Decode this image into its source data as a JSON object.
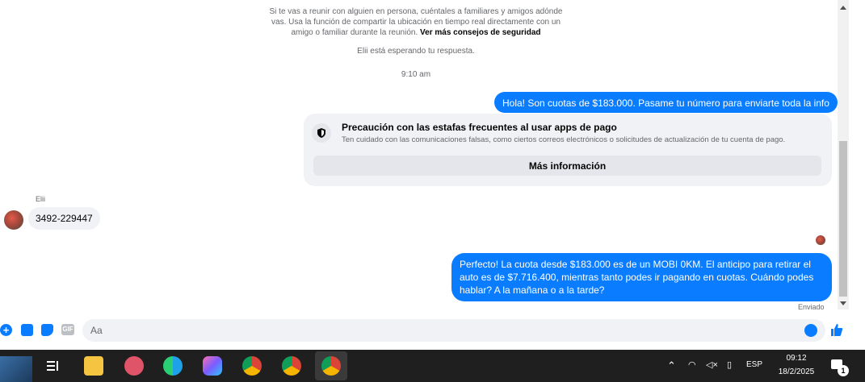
{
  "chat": {
    "safety_notice": "Si te vas a reunir con alguien en persona, cuéntales a familiares y amigos adónde vas. Usa la función de compartir la ubicación en tiempo real directamente con un amigo o familiar durante la reunión.",
    "safety_link": "Ver más consejos de seguridad",
    "waiting_text": "Elii está esperando tu respuesta.",
    "timestamp": "9:10 am",
    "msg_out_1": "Hola! Son cuotas de $183.000. Pasame tu número para enviarte toda la info",
    "warning_card": {
      "title": "Precaución con las estafas frecuentes al usar apps de pago",
      "description": "Ten cuidado con las comunicaciones falsas, como ciertos correos electrónicos o solicitudes de actualización de tu cuenta de pago.",
      "button": "Más información"
    },
    "contact_name": "Elii",
    "msg_in_1": "3492-229447",
    "msg_out_2": "Perfecto! La cuota desde $183.000 es de un MOBI 0KM. El anticipo para retirar el auto es de $7.716.400, mientras tanto podes ir pagando en cuotas. Cuándo podes hablar? A la mañana o a la tarde?",
    "status": "Enviado"
  },
  "composer": {
    "placeholder": "Aa",
    "icons": [
      "plus-icon",
      "photo-icon",
      "sticker-icon",
      "gif-icon",
      "emoji-icon",
      "like-icon"
    ],
    "gif_label": "GIF"
  },
  "taskbar": {
    "apps": [
      "task-view-icon",
      "file-explorer-icon",
      "snipping-tool-icon",
      "edge-icon",
      "copilot-icon",
      "chrome-icon",
      "chrome-profile-icon",
      "chrome-profile-active-icon"
    ],
    "language": "ESP",
    "time": "09:12",
    "date": "18/2/2025",
    "notification_count": "1"
  },
  "colors": {
    "accent": "#0a7cff",
    "bubble_in": "#f0f2f5",
    "taskbar": "#1f1f1f"
  }
}
